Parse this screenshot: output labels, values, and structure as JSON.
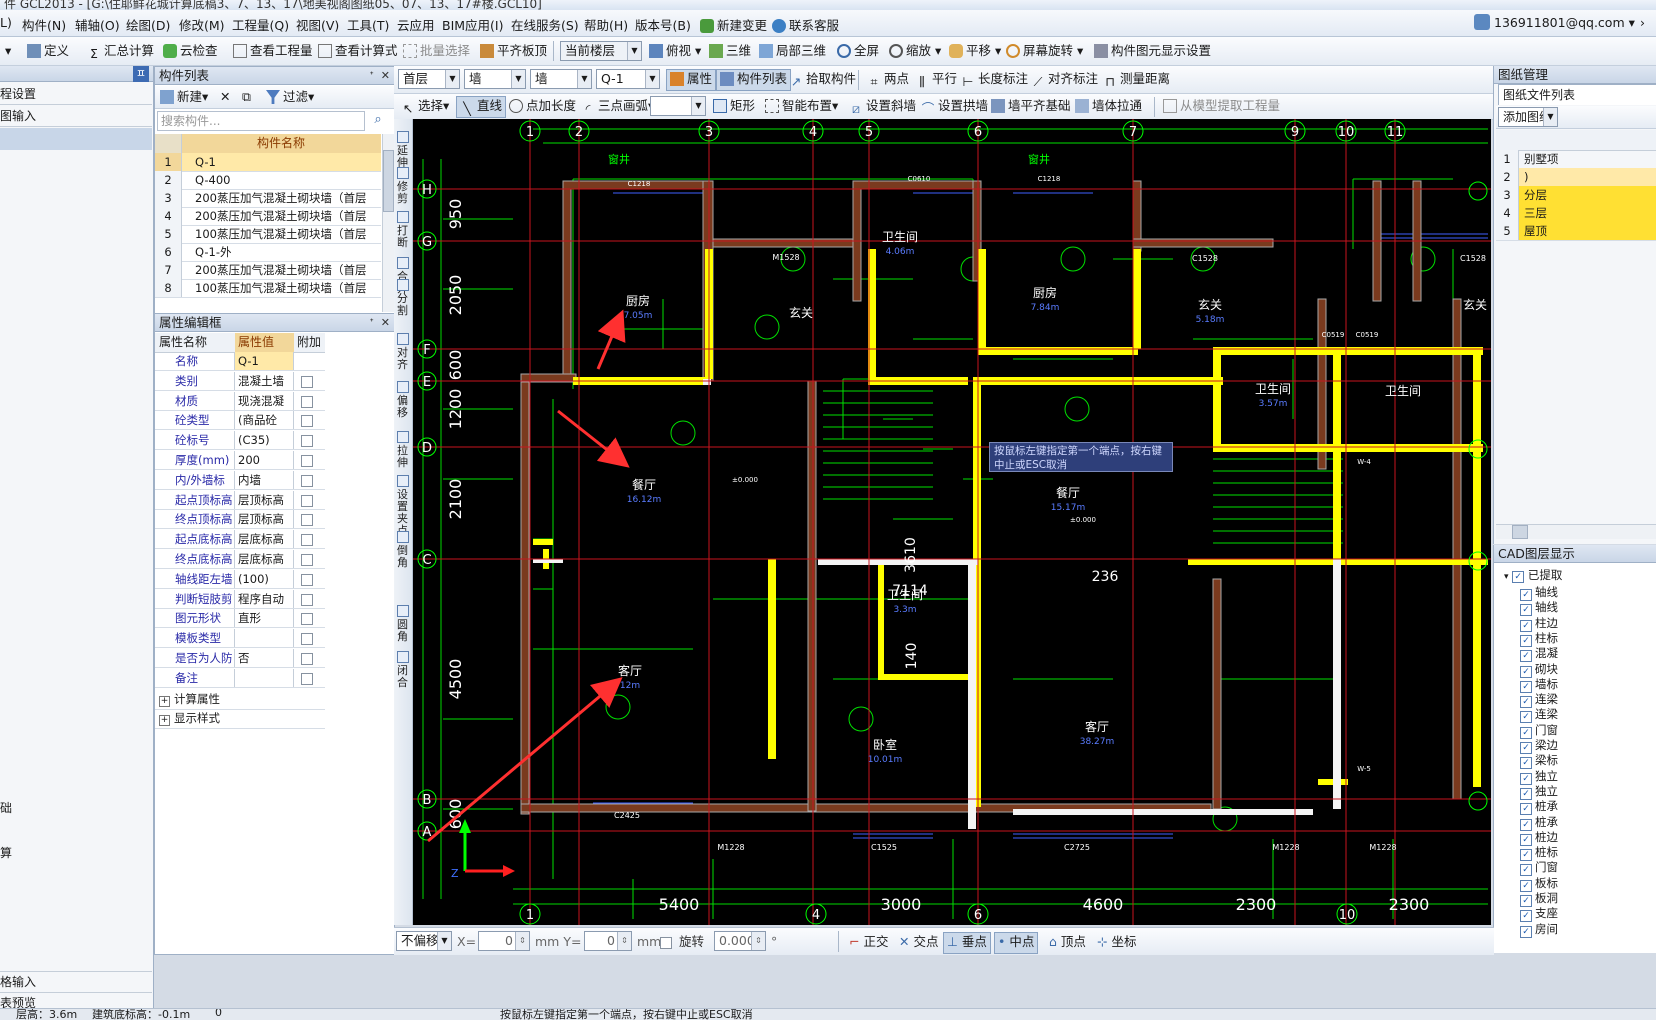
{
  "title_bar": "件 GCL2013 - [G:\\住耶鲜花城计算底稿3、7、13、17\\地美视阁图纸05、07、13、17#楼.GCL10]",
  "menu": {
    "items": [
      "L)",
      "构件(N)",
      "辅轴(O)",
      "绘图(D)",
      "修改(M)",
      "工程量(Q)",
      "视图(V)",
      "工具(T)",
      "云应用",
      "BIM应用(I)",
      "在线服务(S)",
      "帮助(H)",
      "版本号(B)",
      "新建变更",
      "联系客服"
    ],
    "account": "136911801@qq.com"
  },
  "toolbar1": {
    "define": "定义",
    "calc": "汇总计算",
    "cloud_check": "云检查",
    "view_qty": "查看工程量",
    "view_formula": "查看计算式",
    "batch_select": "批量选择",
    "flat_board": "平齐板顶",
    "current_floor": "当前楼层",
    "top_view": "俯视",
    "three_d": "三维",
    "partial_3d": "局部三维",
    "full_screen": "全屏",
    "zoom": "缩放",
    "pan": "平移",
    "rotate": "屏幕旋转",
    "display_settings": "构件图元显示设置"
  },
  "toolbar2": {
    "floor": "首层",
    "type1": "墙",
    "type2": "墙",
    "component": "Q-1",
    "properties": "属性",
    "component_list": "构件列表",
    "pick": "拾取构件",
    "two_points": "两点",
    "parallel": "平行",
    "length_dim": "长度标注",
    "aligned_dim": "对齐标注",
    "measure": "测量距离"
  },
  "toolbar3": {
    "select": "选择",
    "line": "直线",
    "point_length": "点加长度",
    "three_arc": "三点画弧",
    "rect": "矩形",
    "smart_layout": "智能布置",
    "set_slope": "设置斜墙",
    "set_arch": "设置拱墙",
    "wall_flush": "墙平齐基础",
    "wall_pull": "墙体拉通",
    "from_model": "从模型提取工程量"
  },
  "left_nav": {
    "items": [
      "程设置",
      "图输入"
    ],
    "bottom_items": [
      "格输入",
      "表预览"
    ],
    "side_chars": [
      "础",
      "算"
    ]
  },
  "component_list": {
    "title": "构件列表",
    "new_label": "新建",
    "filter_label": "过滤",
    "search_placeholder": "搜索构件...",
    "column": "构件名称",
    "rows": [
      {
        "n": "1",
        "name": "Q-1"
      },
      {
        "n": "2",
        "name": "Q-400"
      },
      {
        "n": "3",
        "name": "200蒸压加气混凝土砌块墙（首层"
      },
      {
        "n": "4",
        "name": "200蒸压加气混凝土砌块墙（首层"
      },
      {
        "n": "5",
        "name": "100蒸压加气混凝土砌块墙（首层"
      },
      {
        "n": "6",
        "name": "Q-1-外"
      },
      {
        "n": "7",
        "name": "200蒸压加气混凝土砌块墙（首层"
      },
      {
        "n": "8",
        "name": "100蒸压加气混凝土砌块墙（首层"
      }
    ]
  },
  "properties": {
    "title": "属性编辑框",
    "col_name": "属性名称",
    "col_value": "属性值",
    "col_extra": "附加",
    "rows": [
      {
        "name": "名称",
        "value": "Q-1"
      },
      {
        "name": "类别",
        "value": "混凝土墙"
      },
      {
        "name": "材质",
        "value": "现浇混凝"
      },
      {
        "name": "砼类型",
        "value": "(商品砼"
      },
      {
        "name": "砼标号",
        "value": "(C35)"
      },
      {
        "name": "厚度(mm)",
        "value": "200"
      },
      {
        "name": "内/外墙标",
        "value": "内墙"
      },
      {
        "name": "起点顶标高",
        "value": "层顶标高"
      },
      {
        "name": "终点顶标高",
        "value": "层顶标高"
      },
      {
        "name": "起点底标高",
        "value": "层底标高"
      },
      {
        "name": "终点底标高",
        "value": "层底标高"
      },
      {
        "name": "轴线距左墙",
        "value": "(100)"
      },
      {
        "name": "判断短肢剪",
        "value": "程序自动"
      },
      {
        "name": "图元形状",
        "value": "直形"
      },
      {
        "name": "模板类型",
        "value": ""
      },
      {
        "name": "是否为人防",
        "value": "否"
      },
      {
        "name": "备注",
        "value": ""
      }
    ],
    "groups": [
      "计算属性",
      "显示样式"
    ]
  },
  "vertical_tools": [
    "延伸",
    "修剪",
    "打断",
    "合并",
    "分割",
    "对齐",
    "偏移",
    "拉伸",
    "设置夹点",
    "倒角",
    "圆角",
    "闭合"
  ],
  "cad": {
    "axis_top": [
      "1",
      "2",
      "3",
      "4",
      "5",
      "6",
      "7",
      "9",
      "10",
      "11"
    ],
    "axis_bottom": [
      "1",
      "4",
      "6",
      "10"
    ],
    "axis_left": [
      "H",
      "G",
      "F",
      "E",
      "D",
      "C",
      "B",
      "A"
    ],
    "dims_left": [
      "950",
      "2050",
      "600",
      "1200",
      "2100",
      "4500",
      "600"
    ],
    "dims_bottom": [
      "5400",
      "3000",
      "4600",
      "2300",
      "2300"
    ],
    "rooms": [
      {
        "name": "厨房",
        "area": "7.05m"
      },
      {
        "name": "玄关",
        "area": ""
      },
      {
        "name": "卫生间",
        "area": "4.06m"
      },
      {
        "name": "厨房",
        "area": "7.84m"
      },
      {
        "name": "玄关",
        "area": "5.18m"
      },
      {
        "name": "玄关",
        "area": ""
      },
      {
        "name": "卫生间",
        "area": "3.57m"
      },
      {
        "name": "卫生间",
        "area": ""
      },
      {
        "name": "餐厅",
        "area": "16.12m"
      },
      {
        "name": "餐厅",
        "area": "15.17m"
      },
      {
        "name": "客厅",
        "area": "12m"
      },
      {
        "name": "卫生间",
        "area": "3.3m"
      },
      {
        "name": "卧室",
        "area": "10.01m"
      },
      {
        "name": "客厅",
        "area": "38.27m"
      }
    ],
    "labels": [
      "窗井",
      "窗井",
      "M1528",
      "C1528",
      "C1528",
      "C2425",
      "M1228",
      "C1525",
      "C2725",
      "M1228",
      "M1228",
      "236",
      "3610",
      "7114",
      "140",
      "±0.000",
      "±0.000",
      "W-4",
      "W-5",
      "C1218",
      "C0610",
      "C1218",
      "C0519",
      "C0519"
    ],
    "tooltip": "按鼠标左键指定第一个端点，按右键中止或ESC取消"
  },
  "right_panel": {
    "title": "图纸管理",
    "tab": "图纸文件列表",
    "add_button": "添加图纸",
    "rows": [
      {
        "n": "1",
        "text": "别墅项"
      },
      {
        "n": "2",
        "text": ")"
      },
      {
        "n": "3",
        "text": "分层"
      },
      {
        "n": "4",
        "text": "三层"
      },
      {
        "n": "5",
        "text": "屋顶"
      }
    ],
    "layer_title": "CAD图层显示",
    "layer_root": "已提取",
    "layers": [
      "轴线",
      "轴线",
      "柱边",
      "柱标",
      "混凝",
      "砌块",
      "墙标",
      "连梁",
      "连梁",
      "门窗",
      "梁边",
      "梁标",
      "独立",
      "独立",
      "桩承",
      "桩承",
      "桩边",
      "桩标",
      "门窗",
      "板标",
      "板洞",
      "支座",
      "房间"
    ]
  },
  "bottom_toolbar": {
    "offset_mode": "不偏移",
    "x_label": "X=",
    "x_value": "0",
    "y_label": "mm Y=",
    "y_value": "0",
    "mm": "mm",
    "rotate_label": "旋转",
    "rotate_value": "0.000",
    "degree": "°",
    "snaps": [
      "正交",
      "交点",
      "垂点",
      "中点",
      "顶点",
      "坐标"
    ]
  },
  "status_bar": {
    "floor_height": "层高：3.6m",
    "base_elev": "建筑底标高：-0.1m",
    "zero": "0",
    "hint": "按鼠标左键指定第一个端点，按右键中止或ESC取消"
  },
  "colors": {
    "cad_bg": "#000000",
    "wall_yellow": "#ffff00",
    "grid_green": "#00ff00",
    "axis_red": "#ff0000",
    "dim_white": "#ffffff",
    "selection": "#ffe9a8"
  }
}
